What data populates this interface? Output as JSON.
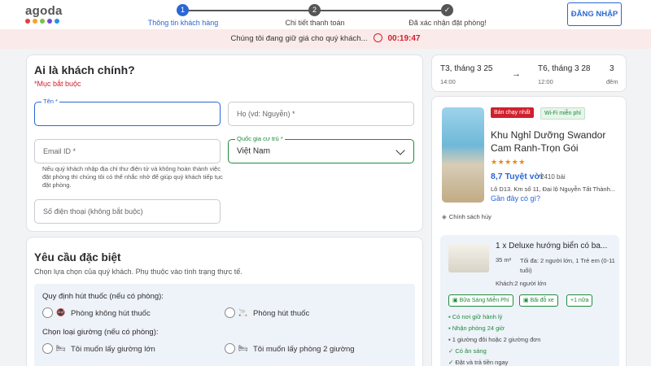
{
  "header": {
    "logo_text": "agoda",
    "logo_dot_colors": [
      "#e4403a",
      "#f5a623",
      "#7cc242",
      "#6d4bd8",
      "#2a8ee6"
    ],
    "steps": [
      {
        "number": "1",
        "label": "Thông tin khách hàng",
        "state": "active"
      },
      {
        "number": "2",
        "label": "Chi tiết thanh toán",
        "state": "pending"
      },
      {
        "number": "✓",
        "label": "Đã xác nhận đặt phòng!",
        "state": "pending"
      }
    ],
    "login_label": "ĐĂNG NHẬP"
  },
  "timer": {
    "message": "Chúng tôi đang giữ giá cho quý khách...",
    "time": "00:19:47"
  },
  "guest_form": {
    "title": "Ai là khách chính?",
    "required_note": "*Mục bắt buộc",
    "first_name_label": "Tên *",
    "last_name_placeholder": "Họ (vd: Nguyễn) *",
    "email_placeholder": "Email ID *",
    "email_hint": "Nếu quý khách nhập địa chỉ thư điện tử và không hoàn thành việc đặt phòng thì chúng tôi có thể nhắc nhở để giúp quý khách tiếp tục đặt phòng.",
    "country_label": "Quốc gia cư trú *",
    "country_value": "Việt Nam",
    "phone_placeholder": "Số điện thoại (không bắt buộc)"
  },
  "special_requests": {
    "title": "Yêu cầu đặc biệt",
    "subtitle": "Chọn lựa chọn của quý khách. Phụ thuộc vào tình trạng thực tế.",
    "smoking_title": "Quy định hút thuốc (nếu có phòng):",
    "smoking_options": [
      "Phòng không hút thuốc",
      "Phòng hút thuốc"
    ],
    "bed_title": "Chọn loại giường (nếu có phòng):",
    "bed_options": [
      "Tôi muốn lấy giường lớn",
      "Tôi muốn lấy phòng 2 giường"
    ]
  },
  "dates": {
    "checkin": "T3, tháng 3 25",
    "checkin_time": "14:00",
    "checkout": "T6, tháng 3 28",
    "checkout_time": "12:00",
    "nights": "3",
    "nights_label": "đêm"
  },
  "hotel": {
    "badge_bestseller": "Bán chạy nhất",
    "badge_wifi": "Wi-Fi miễn phí",
    "name": "Khu Nghỉ Dưỡng Swandor Cam Ranh-Trọn Gói",
    "stars": 5,
    "rating": "8,7 Tuyệt vời",
    "reviews": "2410 bài",
    "address": "Lô D13. Km số 11, Đại lộ Nguyễn Tất Thành...",
    "nearby_link": "Gần đây có gì?",
    "policy": "Chính sách hủy",
    "room": {
      "title": "1 x Deluxe hướng biển có ba...",
      "size": "35 m²",
      "occupancy": "Tối đa: 2 người lớn, 1 Trẻ em (0-11 tuổi)",
      "guests": "Khách:2 người lớn",
      "amenities": [
        "Bữa Sáng Miễn Phí",
        "Bãi đỗ xe",
        "+1 nữa"
      ],
      "features": [
        {
          "text": "Có nơi giữ hành lý",
          "style": "green"
        },
        {
          "text": "Nhận phòng 24 giờ",
          "style": "green"
        },
        {
          "text": "1 giường đôi hoặc 2 giường đơn",
          "style": "gray"
        },
        {
          "text": "Có ăn sáng",
          "style": "green"
        },
        {
          "text": "Đặt và trả tiền ngay",
          "style": "gray"
        }
      ]
    }
  },
  "colors": {
    "primary_blue": "#2a67d4",
    "accent_red": "#d0202e",
    "success_green": "#1e8a3a"
  }
}
